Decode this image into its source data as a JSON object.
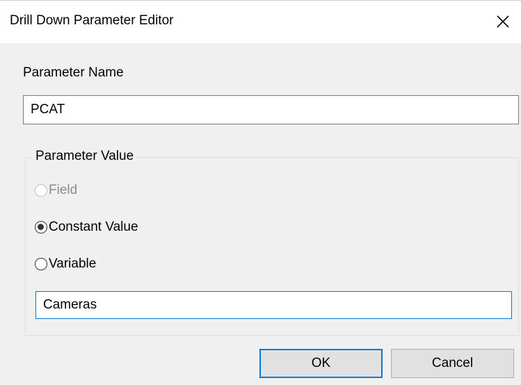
{
  "dialog": {
    "title": "Drill Down Parameter Editor",
    "close_icon": "close-icon"
  },
  "parameter_name": {
    "label": "Parameter Name",
    "value": "PCAT"
  },
  "parameter_value": {
    "group_label": "Parameter Value",
    "options": [
      {
        "label": "Field",
        "checked": false,
        "enabled": false
      },
      {
        "label": "Constant Value",
        "checked": true,
        "enabled": true
      },
      {
        "label": "Variable",
        "checked": false,
        "enabled": true
      }
    ],
    "value": "Cameras"
  },
  "buttons": {
    "ok_label": "OK",
    "cancel_label": "Cancel"
  },
  "colors": {
    "dialog_background": "#f0f0f0",
    "focus_accent": "#0078d7",
    "button_face": "#e1e1e1"
  }
}
